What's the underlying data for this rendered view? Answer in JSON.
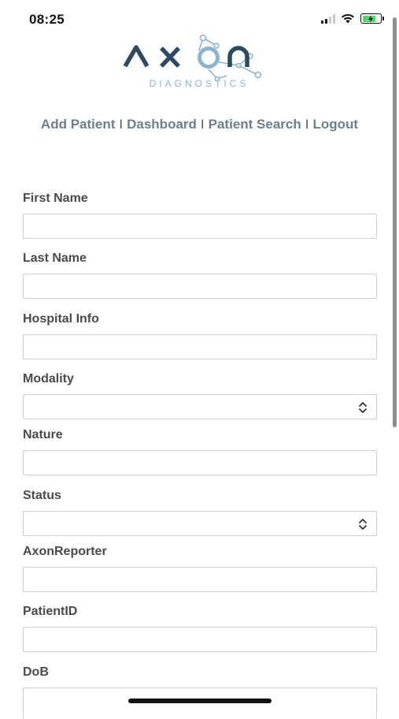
{
  "status_bar": {
    "time": "08:25",
    "battery_charging": true
  },
  "logo": {
    "name": "AXON",
    "tagline": "DIAGNOSTICS"
  },
  "nav": {
    "items": [
      "Add Patient",
      "Dashboard",
      "Patient Search",
      "Logout"
    ],
    "separator": "I"
  },
  "form": {
    "fields": [
      {
        "label": "First Name",
        "type": "text",
        "value": ""
      },
      {
        "label": "Last Name",
        "type": "text",
        "value": ""
      },
      {
        "label": "Hospital Info",
        "type": "text",
        "value": ""
      },
      {
        "label": "Modality",
        "type": "select",
        "value": ""
      },
      {
        "label": "Nature",
        "type": "text",
        "value": ""
      },
      {
        "label": "Status",
        "type": "select",
        "value": ""
      },
      {
        "label": "AxonReporter",
        "type": "text",
        "value": ""
      },
      {
        "label": "PatientID",
        "type": "text",
        "value": ""
      },
      {
        "label": "DoB",
        "type": "text",
        "value": ""
      }
    ]
  },
  "colors": {
    "nav_link": "#6b7f8e",
    "logo_dark": "#2c4a63",
    "logo_accent": "#8ab4d6",
    "label": "#4a4a4a",
    "input_border": "#cfcfcf"
  }
}
